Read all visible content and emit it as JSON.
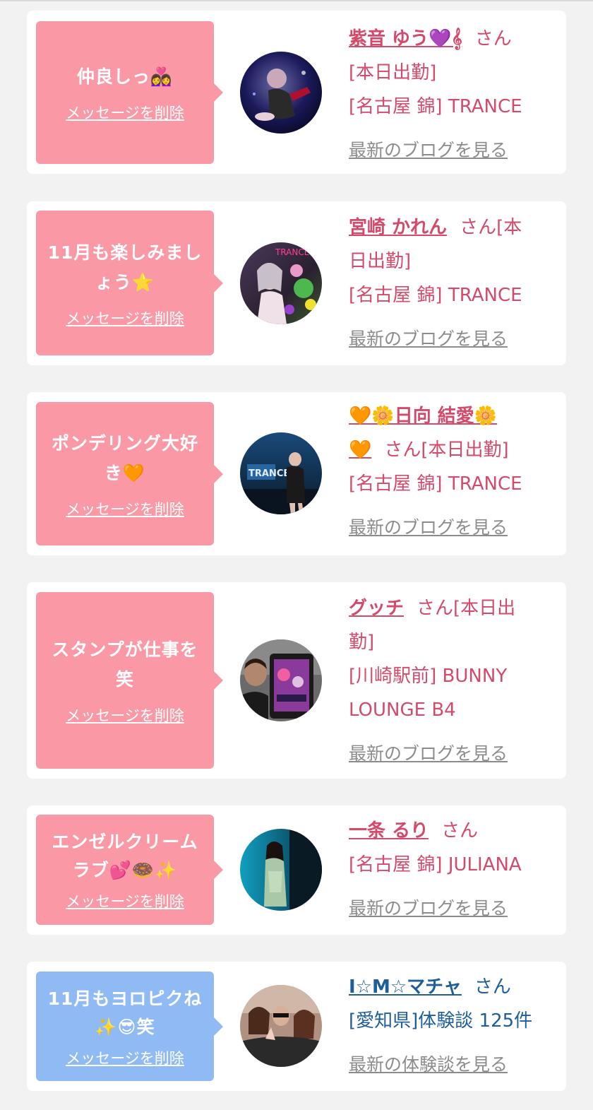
{
  "cards": [
    {
      "bubble_lines": [
        "仲良しっ👩‍❤️‍👩"
      ],
      "delete_label": "メッセージを削除",
      "name": "紫音 ゆう💜𝄞",
      "san": "さん",
      "info_lines": [
        "[本日出勤]",
        "[名古屋 錦] TRANCE"
      ],
      "blog_link": "最新のブログを見る"
    },
    {
      "bubble_lines": [
        "11月も楽しみまし",
        "ょう⭐"
      ],
      "delete_label": "メッセージを削除",
      "name": "宮崎 かれん",
      "san": "さん[本",
      "info_lines": [
        "日出勤]",
        "[名古屋 錦] TRANCE"
      ],
      "blog_link": "最新のブログを見る"
    },
    {
      "bubble_lines": [
        "ポンデリング大好",
        "き🧡"
      ],
      "delete_label": "メッセージを削除",
      "name": "🧡🌼日向 結愛🌼",
      "name2": "🧡",
      "san": "さん[本日出勤]",
      "info_lines": [
        "[名古屋 錦] TRANCE"
      ],
      "blog_link": "最新のブログを見る"
    },
    {
      "bubble_lines": [
        "スタンプが仕事を",
        "笑"
      ],
      "delete_label": "メッセージを削除",
      "name": "グッチ",
      "san": "さん[本日出",
      "info_lines": [
        "勤]",
        "[川崎駅前] BUNNY",
        "LOUNGE B4"
      ],
      "blog_link": "最新のブログを見る"
    },
    {
      "bubble_lines": [
        "エンゼルクリーム",
        "ラブ💕🍩✨"
      ],
      "delete_label": "メッセージを削除",
      "name": "一条 るり",
      "san": "さん",
      "info_lines": [
        "[名古屋 錦] JULIANA"
      ],
      "blog_link": "最新のブログを見る"
    },
    {
      "bubble_lines": [
        "11月もヨロピクね",
        "✨😎笑"
      ],
      "delete_label": "メッセージを削除",
      "name": "I☆M☆マチャ",
      "san": "さん",
      "info_lines": [
        "[愛知県]体験談 125件"
      ],
      "blog_link": "最新の体験談を見る"
    }
  ],
  "colors": {
    "page_bg": "#f2f2f2",
    "card_bg": "#ffffff",
    "bubble_pink": "#fa98a6",
    "bubble_blue": "#8fbaf3",
    "name_pink": "#d44a6a",
    "name_blue": "#1f5e9a",
    "link_gray": "#8c8c8c"
  }
}
